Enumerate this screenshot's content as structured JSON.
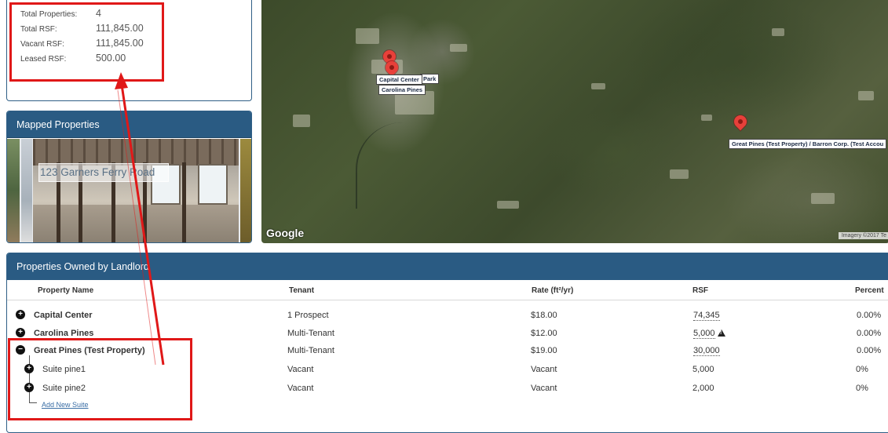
{
  "stats": {
    "items": [
      {
        "label": "Total Properties:",
        "value": "4"
      },
      {
        "label": "Total RSF:",
        "value": "111,845.00"
      },
      {
        "label": "Vacant RSF:",
        "value": "111,845.00"
      },
      {
        "label": "Leased RSF:",
        "value": "500.00"
      }
    ]
  },
  "mapped": {
    "title": "Mapped Properties",
    "caption": "123 Garners Ferry Road"
  },
  "map": {
    "labels": {
      "park": "Park",
      "capital": "Capital Center",
      "carolina": "Carolina Pines",
      "great": "Great Pines (Test Property) / Barron Corp. (Test Accou"
    },
    "logo": "Google",
    "imagery": "Imagery ©2017 Te"
  },
  "properties": {
    "title": "Properties Owned by Landlord",
    "columns": {
      "name": "Property Name",
      "tenant": "Tenant",
      "rate": "Rate (ft²/yr)",
      "rsf": "RSF",
      "percent": "Percent"
    },
    "rows": [
      {
        "name": "Capital Center",
        "tenant": "1 Prospect",
        "rate": "$18.00",
        "rsf": "74,345",
        "percent": "0.00%"
      },
      {
        "name": "Carolina Pines",
        "tenant": "Multi-Tenant",
        "rate": "$12.00",
        "rsf": "5,000",
        "percent": "0.00%"
      },
      {
        "name": "Great Pines (Test Property)",
        "tenant": "Multi-Tenant",
        "rate": "$19.00",
        "rsf": "30,000",
        "percent": "0.00%"
      }
    ],
    "suites": [
      {
        "name": "Suite pine1",
        "tenant": "Vacant",
        "rate": "Vacant",
        "rsf": "5,000",
        "percent": "0%"
      },
      {
        "name": "Suite pine2",
        "tenant": "Vacant",
        "rate": "Vacant",
        "rsf": "2,000",
        "percent": "0%"
      }
    ],
    "add_suite": "Add New Suite"
  },
  "colors": {
    "header": "#2a5b83",
    "annotation": "#e01818",
    "pin": "#e8403a"
  }
}
